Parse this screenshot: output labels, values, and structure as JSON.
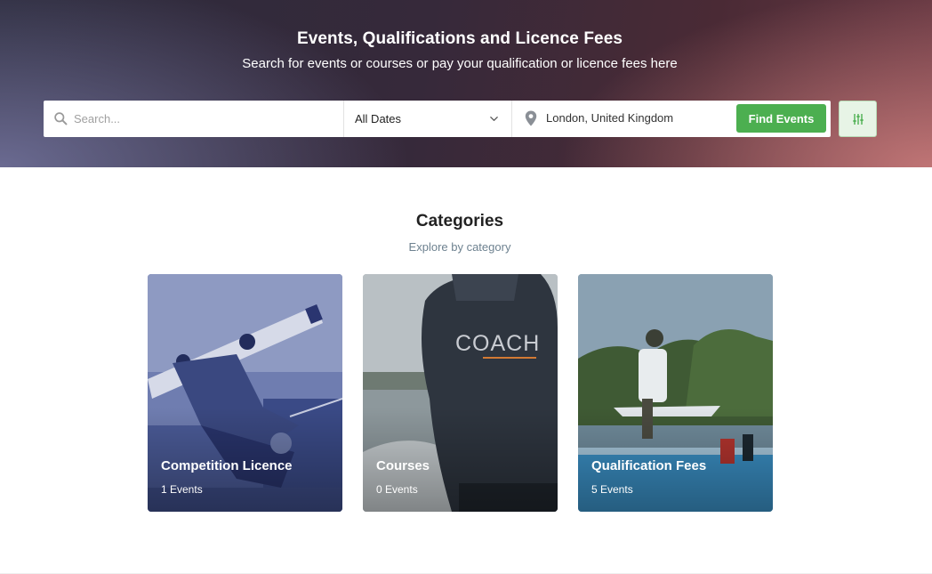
{
  "hero": {
    "title": "Events, Qualifications and Licence Fees",
    "subtitle": "Search for events or courses or pay your qualification or licence fees here"
  },
  "search": {
    "placeholder": "Search...",
    "date_value": "All Dates",
    "location_value": "London, United Kingdom",
    "find_label": "Find Events",
    "icons": [
      "search-icon",
      "chevron-down-icon",
      "map-pin-icon",
      "sliders-icon"
    ]
  },
  "categories": {
    "title": "Categories",
    "subtitle": "Explore by category",
    "items": [
      {
        "label": "Competition Licence",
        "count": "1 Events",
        "tone": "#3e4f8c"
      },
      {
        "label": "Courses",
        "count": "0 Events",
        "tone": "#3a4450"
      },
      {
        "label": "Qualification Fees",
        "count": "5 Events",
        "tone": "#4d86b0"
      }
    ]
  },
  "colors": {
    "accent": "#4caf50",
    "hero_left": "#6e6e96",
    "hero_right": "#c47878",
    "subtitle_text": "#6e8290"
  }
}
